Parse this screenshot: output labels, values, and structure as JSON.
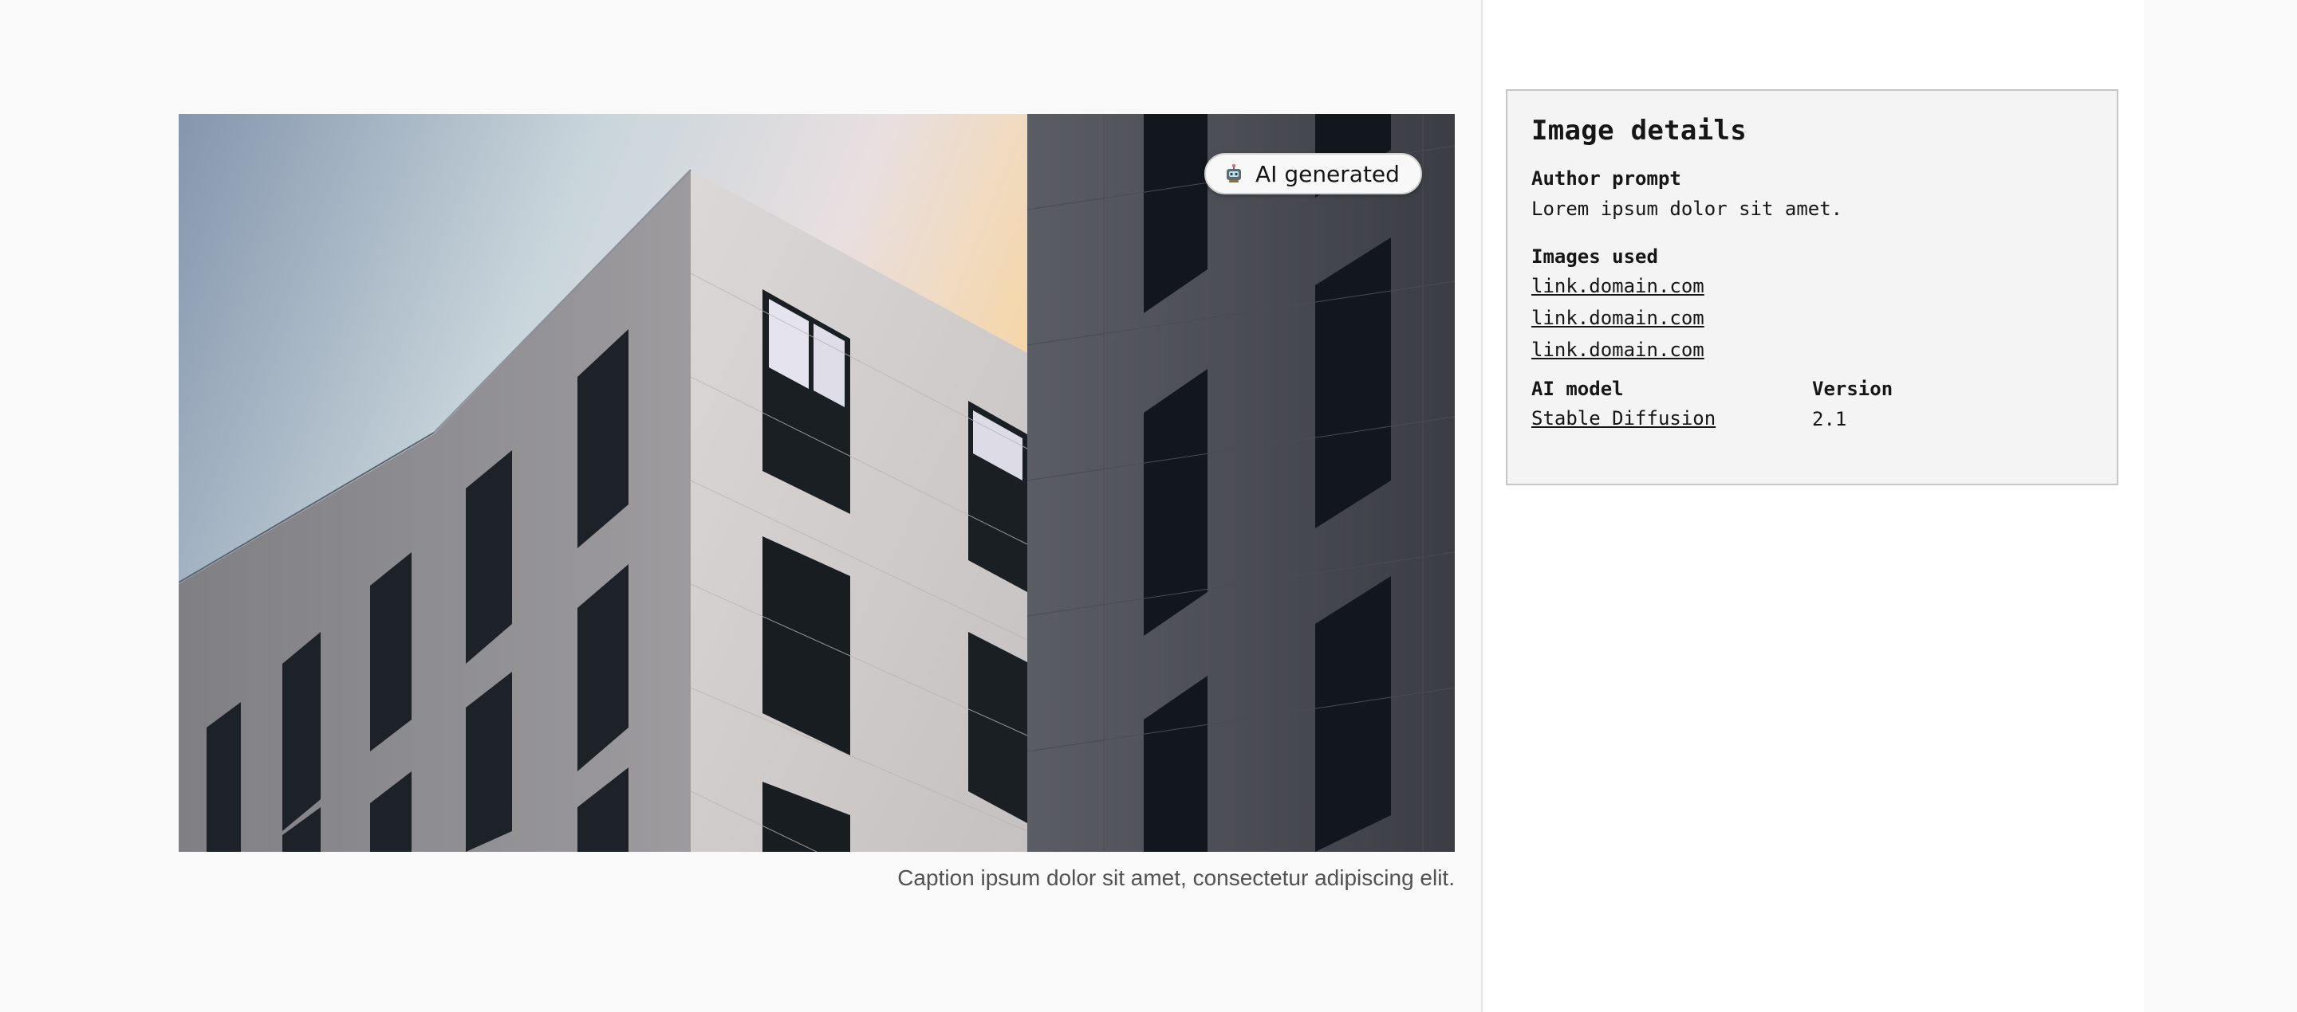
{
  "image": {
    "badge_label": "AI generated",
    "badge_icon": "robot-icon",
    "caption": "Caption ipsum dolor sit amet, consectetur adipiscing elit."
  },
  "details": {
    "title": "Image details",
    "author_prompt_label": "Author prompt",
    "author_prompt_value": "Lorem ipsum dolor sit amet.",
    "images_used_label": "Images used",
    "images_used": [
      "link.domain.com",
      "link.domain.com",
      "link.domain.com"
    ],
    "ai_model_label": "AI model",
    "ai_model_value": "Stable Diffusion",
    "version_label": "Version",
    "version_value": "2.1"
  },
  "colors": {
    "page_bg": "#f9f9f9",
    "panel_bg": "#f4f4f4",
    "panel_border": "#c6c6c6",
    "text": "#161616",
    "caption_text": "#525252"
  }
}
